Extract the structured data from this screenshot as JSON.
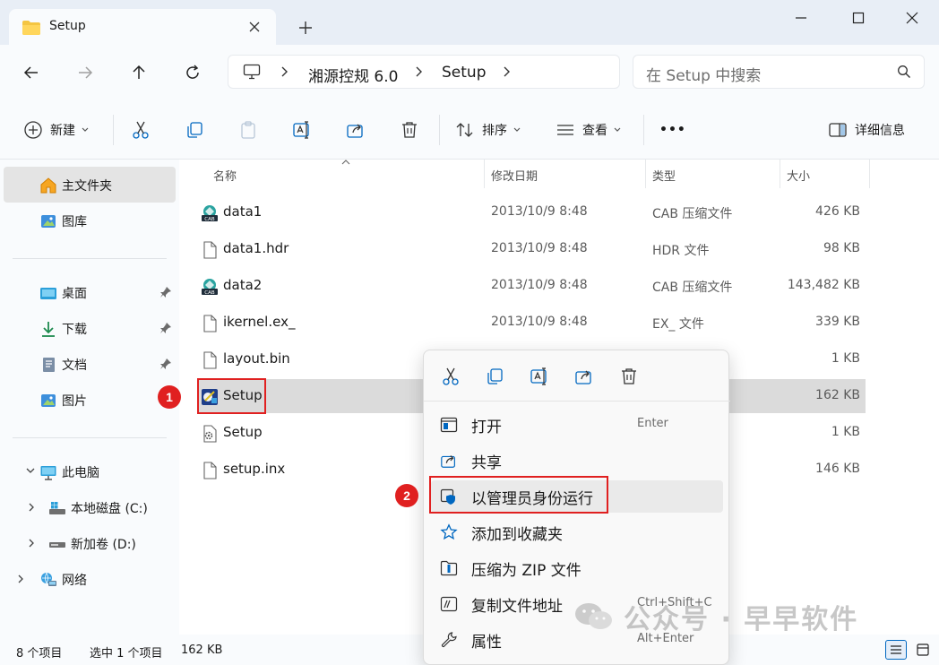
{
  "window": {
    "tab_title": "Setup",
    "new_tab": "+"
  },
  "address": {
    "crumbs": [
      "湘源控规 6.0",
      "Setup"
    ],
    "search_placeholder": "在 Setup 中搜索"
  },
  "toolbar": {
    "new_label": "新建",
    "sort_label": "排序",
    "view_label": "查看",
    "more_label": "•••",
    "details_label": "详细信息"
  },
  "sidebar": {
    "home": "主文件夹",
    "gallery": "图库",
    "desktop": "桌面",
    "downloads": "下载",
    "documents": "文档",
    "pictures": "图片",
    "this_pc": "此电脑",
    "drive_c": "本地磁盘 (C:)",
    "drive_d": "新加卷 (D:)",
    "network": "网络"
  },
  "columns": {
    "name": "名称",
    "modified": "修改日期",
    "type": "类型",
    "size": "大小"
  },
  "files": [
    {
      "name": "data1",
      "date": "2013/10/9 8:48",
      "type": "CAB 压缩文件",
      "size": "426 KB",
      "icon": "cab-file-icon"
    },
    {
      "name": "data1.hdr",
      "date": "2013/10/9 8:48",
      "type": "HDR 文件",
      "size": "98 KB",
      "icon": "file-icon"
    },
    {
      "name": "data2",
      "date": "2013/10/9 8:48",
      "type": "CAB 压缩文件",
      "size": "143,482 KB",
      "icon": "cab-file-icon"
    },
    {
      "name": "ikernel.ex_",
      "date": "2013/10/9 8:48",
      "type": "EX_ 文件",
      "size": "339 KB",
      "icon": "file-icon"
    },
    {
      "name": "layout.bin",
      "date": "",
      "type": "",
      "size": "1 KB",
      "icon": "file-icon"
    },
    {
      "name": "Setup",
      "date": "",
      "type": "",
      "size": "162 KB",
      "icon": "setup-exe-icon"
    },
    {
      "name": "Setup",
      "date": "",
      "type": "",
      "size": "1 KB",
      "icon": "settings-file-icon"
    },
    {
      "name": "setup.inx",
      "date": "",
      "type": "",
      "size": "146 KB",
      "icon": "file-icon"
    }
  ],
  "context_menu": {
    "items": [
      {
        "label": "打开",
        "shortcut": "Enter"
      },
      {
        "label": "共享",
        "shortcut": ""
      },
      {
        "label": "以管理员身份运行",
        "shortcut": ""
      },
      {
        "label": "添加到收藏夹",
        "shortcut": ""
      },
      {
        "label": "压缩为 ZIP 文件",
        "shortcut": ""
      },
      {
        "label": "复制文件地址",
        "shortcut": "Ctrl+Shift+C"
      },
      {
        "label": "属性",
        "shortcut": "Alt+Enter"
      }
    ]
  },
  "annotations": {
    "badge1": "1",
    "badge2": "2"
  },
  "status": {
    "count": "8 个项目",
    "selected": "选中 1 个项目",
    "selected_size": "162 KB"
  },
  "watermark": "公众号 · 早早软件",
  "colors": {
    "accent": "#0067c0",
    "highlight_red": "#e02020",
    "folder_yellow": "#f4c542"
  }
}
